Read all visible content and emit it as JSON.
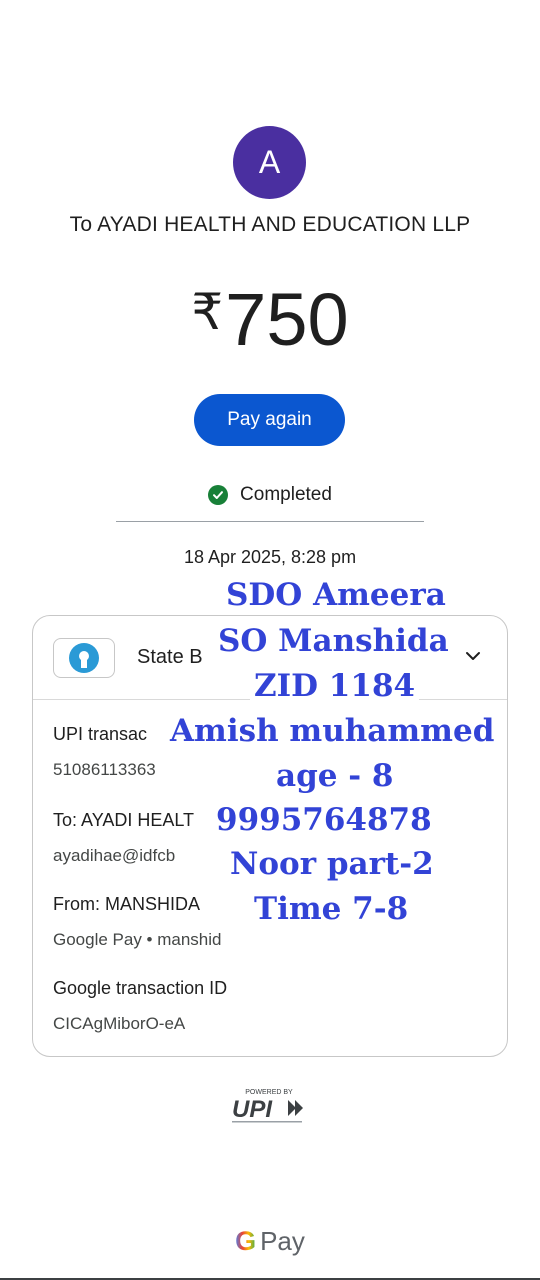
{
  "avatar": {
    "initial": "A"
  },
  "payee": {
    "label": "To AYADI HEALTH AND EDUCATION LLP"
  },
  "amount": {
    "currency_symbol": "₹",
    "value": "750"
  },
  "actions": {
    "pay_again_label": "Pay again"
  },
  "status": {
    "label": "Completed"
  },
  "timestamp": {
    "datetime": "18 Apr 2025, 8:28 pm"
  },
  "card": {
    "bank_name": "State B",
    "upi_label": "UPI transac",
    "upi_value": "51086113363",
    "to_label": "To: AYADI HEALT",
    "to_value": "ayadihae@idfcb",
    "from_label": "From: MANSHIDA",
    "from_value": "Google Pay • manshid",
    "google_txn_label": "Google transaction ID",
    "google_txn_value": "CICAgMiborO-eA"
  },
  "overlay": {
    "lines": [
      "SDO Ameera",
      "SO Manshida",
      "ZID 1184",
      "Amish muhammed",
      "age - 8",
      "9995764878",
      "Noor part-2",
      "Time 7-8"
    ]
  },
  "footer": {
    "powered_by": "POWERED BY",
    "upi_text": "UPI",
    "gpay_text": "Pay",
    "google_g": "G"
  }
}
